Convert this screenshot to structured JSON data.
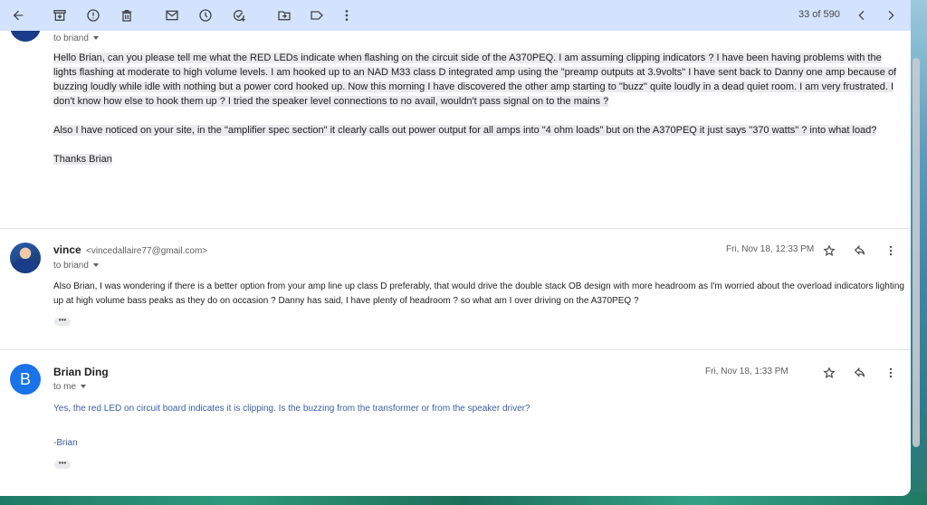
{
  "toolbar": {
    "icons": [
      "back-arrow-icon",
      "archive-icon",
      "report-spam-icon",
      "delete-icon",
      "mark-unread-icon",
      "snooze-icon",
      "add-task-icon",
      "move-to-icon",
      "label-icon",
      "more-vertical-icon"
    ],
    "count": "33 of 590"
  },
  "messages": [
    {
      "to": "to briand",
      "body_paragraphs": [
        "Hello Brian, can you please tell me what the RED LEDs indicate when flashing on the circuit side of the A370PEQ. I am assuming clipping indicators ? I have been having problems with the lights flashing at moderate to high volume levels. I am hooked up to an NAD M33 class D integrated amp using the \"preamp outputs at 3.9volts\" I have sent back to Danny one amp because of buzzing loudly while idle with nothing but a power cord hooked up. Now this morning I have discovered the other amp starting to \"buzz\" quite loudly in a dead quiet room. I am very frustrated. I don't know how else to hook them up ? I tried the speaker level connections to no avail, wouldn't pass signal on to the mains ?",
        "Also I have noticed on your site, in the \"amplifier spec section\" it clearly calls out power output for all amps into \"4 ohm loads\" but on the A370PEQ it just says \"370 watts\" ? into what load?",
        "Thanks Brian"
      ]
    },
    {
      "sender_name": "vince",
      "sender_email": "<vincedallaire77@gmail.com>",
      "to": "to briand",
      "date": "Fri, Nov 18, 12:33 PM",
      "body": "Also Brian, I was wondering if there is a better option from your amp line up class D preferably, that would drive the double stack OB design with more headroom as I'm worried about the overload indicators lighting up at high volume bass peaks as they do on occasion ?  Danny has said, I have plenty of headroom ? so what am I over driving on the A370PEQ ?",
      "more": "•••"
    },
    {
      "avatar_letter": "B",
      "sender_name": "Brian Ding",
      "to": "to me",
      "date": "Fri, Nov 18, 1:33 PM",
      "body": "Yes, the red LED on circuit board indicates it is clipping.  Is the buzzing from the transformer or from the speaker driver?",
      "signature": "-Brian",
      "more": "•••"
    }
  ]
}
